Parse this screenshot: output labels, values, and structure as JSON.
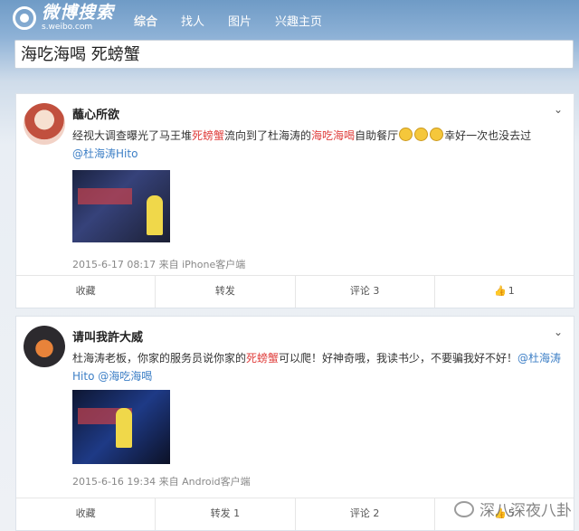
{
  "header": {
    "logo_main": "微博搜索",
    "logo_sub": "s.weibo.com",
    "nav": [
      "综合",
      "找人",
      "图片",
      "兴趣主页"
    ]
  },
  "search": {
    "query": "海吃海喝 死螃蟹"
  },
  "posts": [
    {
      "username": "蘸心所欲",
      "text_a": "经视大调查曝光了马王堆",
      "text_hl1": "死螃蟹",
      "text_b": "流向到了杜海涛的",
      "text_hl2": "海吃海喝",
      "text_c": "自助餐厅",
      "text_d": "幸好一次也没去过",
      "mention": "@杜海涛Hito",
      "meta": "2015-6-17 08:17 来自 iPhone客户端",
      "actions": {
        "collect": "收藏",
        "repost": "转发",
        "comment": "评论 3",
        "like": "1"
      }
    },
    {
      "username": "请叫我許大威",
      "text_a": "杜海涛老板，你家的服务员说你家的",
      "text_hl1": "死螃蟹",
      "text_b": "可以爬！好神奇哦，我读书少，不要骗我好不好！",
      "mention": "@杜海涛Hito",
      "text_hl2": "@海吃海喝",
      "meta": "2015-6-16 19:34 来自 Android客户端",
      "actions": {
        "collect": "收藏",
        "repost": "转发 1",
        "comment": "评论 2",
        "like": "5"
      }
    }
  ],
  "watermark": "深八深夜八卦"
}
